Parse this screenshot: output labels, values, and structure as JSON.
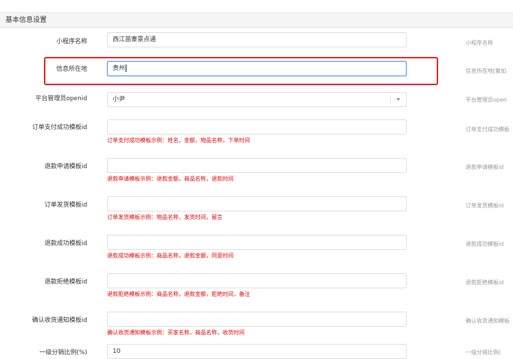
{
  "panel": {
    "title": "基本信息设置"
  },
  "fields": [
    {
      "label": "小程序名称",
      "value": "西江苗寨景点通",
      "right_label": "小程序名称"
    },
    {
      "label": "信息所在地",
      "value": "贵州",
      "right_label": "信息所在地[繁如"
    },
    {
      "label": "平台管理员openid",
      "value": "小尹",
      "right_label": "平台管理员open"
    },
    {
      "label": "订单支付成功模板id",
      "value": "",
      "hint": "订单支付成功模板示例：姓名，金额，物品名称，下单时间",
      "right_label": "订单支付成功模板"
    },
    {
      "label": "退款申请模板id",
      "value": "",
      "hint": "退款申请模板示例：退款金额，商品名称，退款时间",
      "right_label": "退款申请模板id"
    },
    {
      "label": "订单发货模板id",
      "value": "",
      "hint": "订单发货模板示例：物品名称，发货时间，留言",
      "right_label": "订单发货模板id"
    },
    {
      "label": "退款成功模板id",
      "value": "",
      "hint": "退款成功模板示例：商品名称，退款金额，同意时间",
      "right_label": "退款成功模板id"
    },
    {
      "label": "退款拒绝模板id",
      "value": "",
      "hint": "退款拒绝模板示例：商品名称，退款金额，拒绝时间，备注",
      "right_label": "退款拒绝模板id"
    },
    {
      "label": "确认收货通知模板id",
      "value": "",
      "hint": "确认收货通知模板示例：买家名称，商品名称，收货时间",
      "right_label": "确认收货通知模板"
    },
    {
      "label": "一级分销比例(%)",
      "value": "10",
      "right_label": "一级分销比例("
    }
  ],
  "colors": {
    "highlight": "#e81818",
    "hint": "#e00000",
    "focus": "#4d90fe"
  },
  "icons": {
    "select_arrow": "chevron-down-icon"
  }
}
